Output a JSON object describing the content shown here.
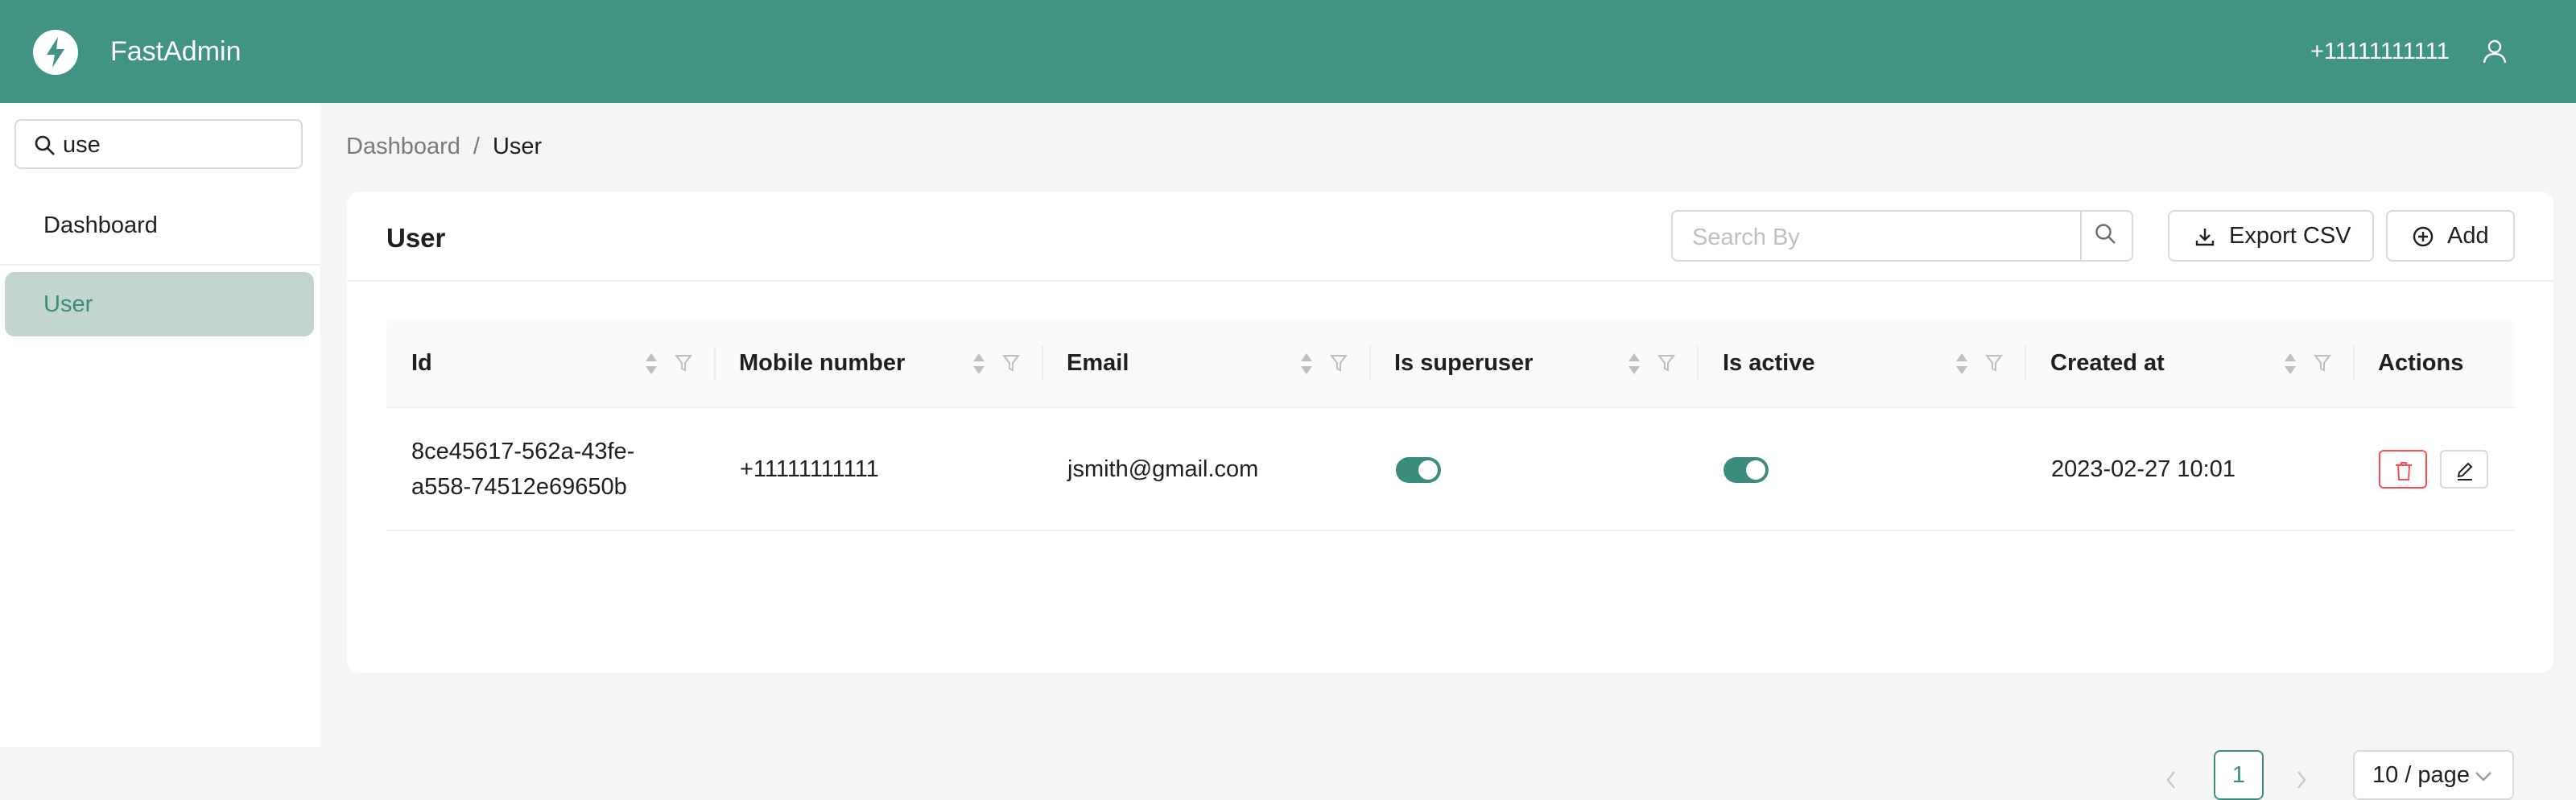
{
  "app": {
    "title": "FastAdmin",
    "logo_icon": "bolt-icon"
  },
  "header": {
    "user_label": "+11111111111",
    "user_icon": "user-icon"
  },
  "sidebar": {
    "search": {
      "value": "use",
      "placeholder": ""
    },
    "items": [
      {
        "label": "Dashboard",
        "active": false
      },
      {
        "label": "User",
        "active": true
      }
    ]
  },
  "breadcrumb": {
    "items": [
      "Dashboard",
      "User"
    ],
    "separator": "/"
  },
  "page": {
    "title": "User",
    "search_placeholder": "Search By",
    "export_label": "Export CSV",
    "add_label": "Add"
  },
  "table": {
    "columns": [
      "Id",
      "Mobile number",
      "Email",
      "Is superuser",
      "Is active",
      "Created at",
      "Actions"
    ],
    "rows": [
      {
        "id_line1": "8ce45617-562a-43fe-",
        "id_line2": "a558-74512e69650b",
        "mobile_number": "+11111111111",
        "email": "jsmith@gmail.com",
        "is_superuser": true,
        "is_active": true,
        "created_at": "2023-02-27 10:01"
      }
    ]
  },
  "pagination": {
    "current": "1",
    "page_size": "10 / page"
  },
  "colors": {
    "primary": "#419383",
    "accent": "#3c8c7b",
    "sidebar_active_bg": "#c2d6cf",
    "danger": "#ff4d4f"
  }
}
